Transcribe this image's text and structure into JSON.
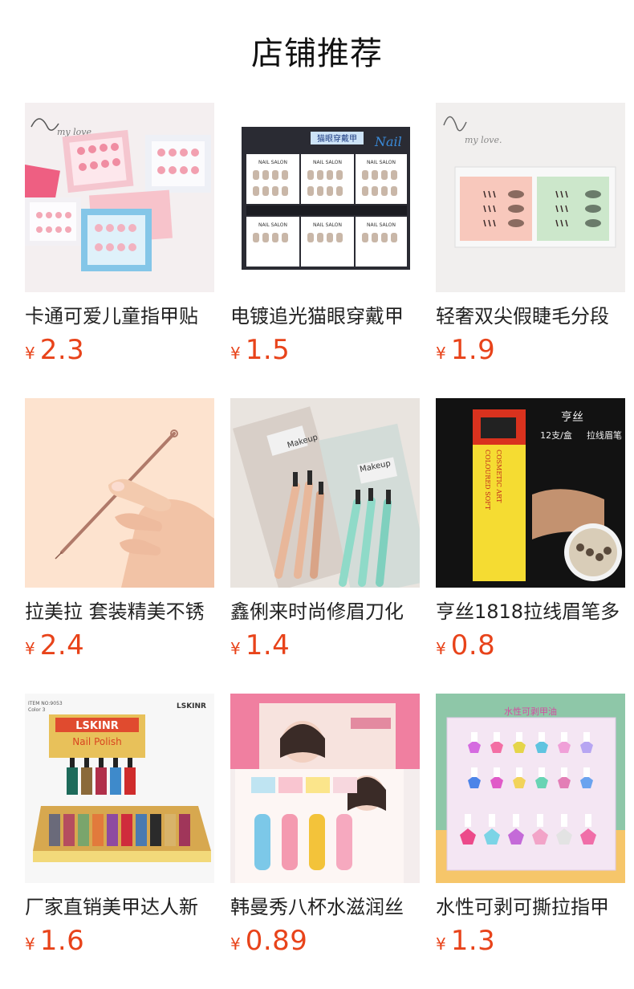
{
  "header": {
    "title": "店铺推荐"
  },
  "products": [
    {
      "name": "卡通可爱儿童指甲贴",
      "currency": "¥",
      "price": "2.3",
      "image": "cartoon-nail-stickers-photo"
    },
    {
      "name": "电镀追光猫眼穿戴甲",
      "currency": "¥",
      "price": "1.5",
      "image": "cat-eye-press-on-nails-photo"
    },
    {
      "name": "轻奢双尖假睫毛分段",
      "currency": "¥",
      "price": "1.9",
      "image": "false-eyelashes-photo"
    },
    {
      "name": "拉美拉 套装精美不锈",
      "currency": "¥",
      "price": "2.4",
      "image": "stainless-tool-photo"
    },
    {
      "name": "鑫俐来时尚修眉刀化",
      "currency": "¥",
      "price": "1.4",
      "image": "eyebrow-razor-set-photo"
    },
    {
      "name": "亨丝1818拉线眉笔多",
      "currency": "¥",
      "price": "0.8",
      "image": "pull-line-eyebrow-pencil-photo"
    },
    {
      "name": "厂家直销美甲达人新",
      "currency": "¥",
      "price": "1.6",
      "image": "nail-polish-display-photo"
    },
    {
      "name": "韩曼秀八杯水滋润丝",
      "currency": "¥",
      "price": "0.89",
      "image": "lip-balm-set-photo"
    },
    {
      "name": "水性可剥可撕拉指甲",
      "currency": "¥",
      "price": "1.3",
      "image": "peelable-nail-polish-photo"
    }
  ],
  "image_text": {
    "p2_brand": "Nail",
    "p2_box_label": "NAIL SALON",
    "p2_title": "猫眼穿戴甲",
    "p6_brand": "亨丝",
    "p6_count": "12支/盒",
    "p6_side": "拉线眉笔",
    "p6_box": "COSMETIC ART",
    "p7_brand": "LSKINR",
    "p7_item": "ITEM NO:9053",
    "p7_color": "Color 3",
    "p7_title": "Nail Polish"
  },
  "colors": {
    "price": "#e8431a",
    "title": "#111111",
    "name": "#222222"
  }
}
